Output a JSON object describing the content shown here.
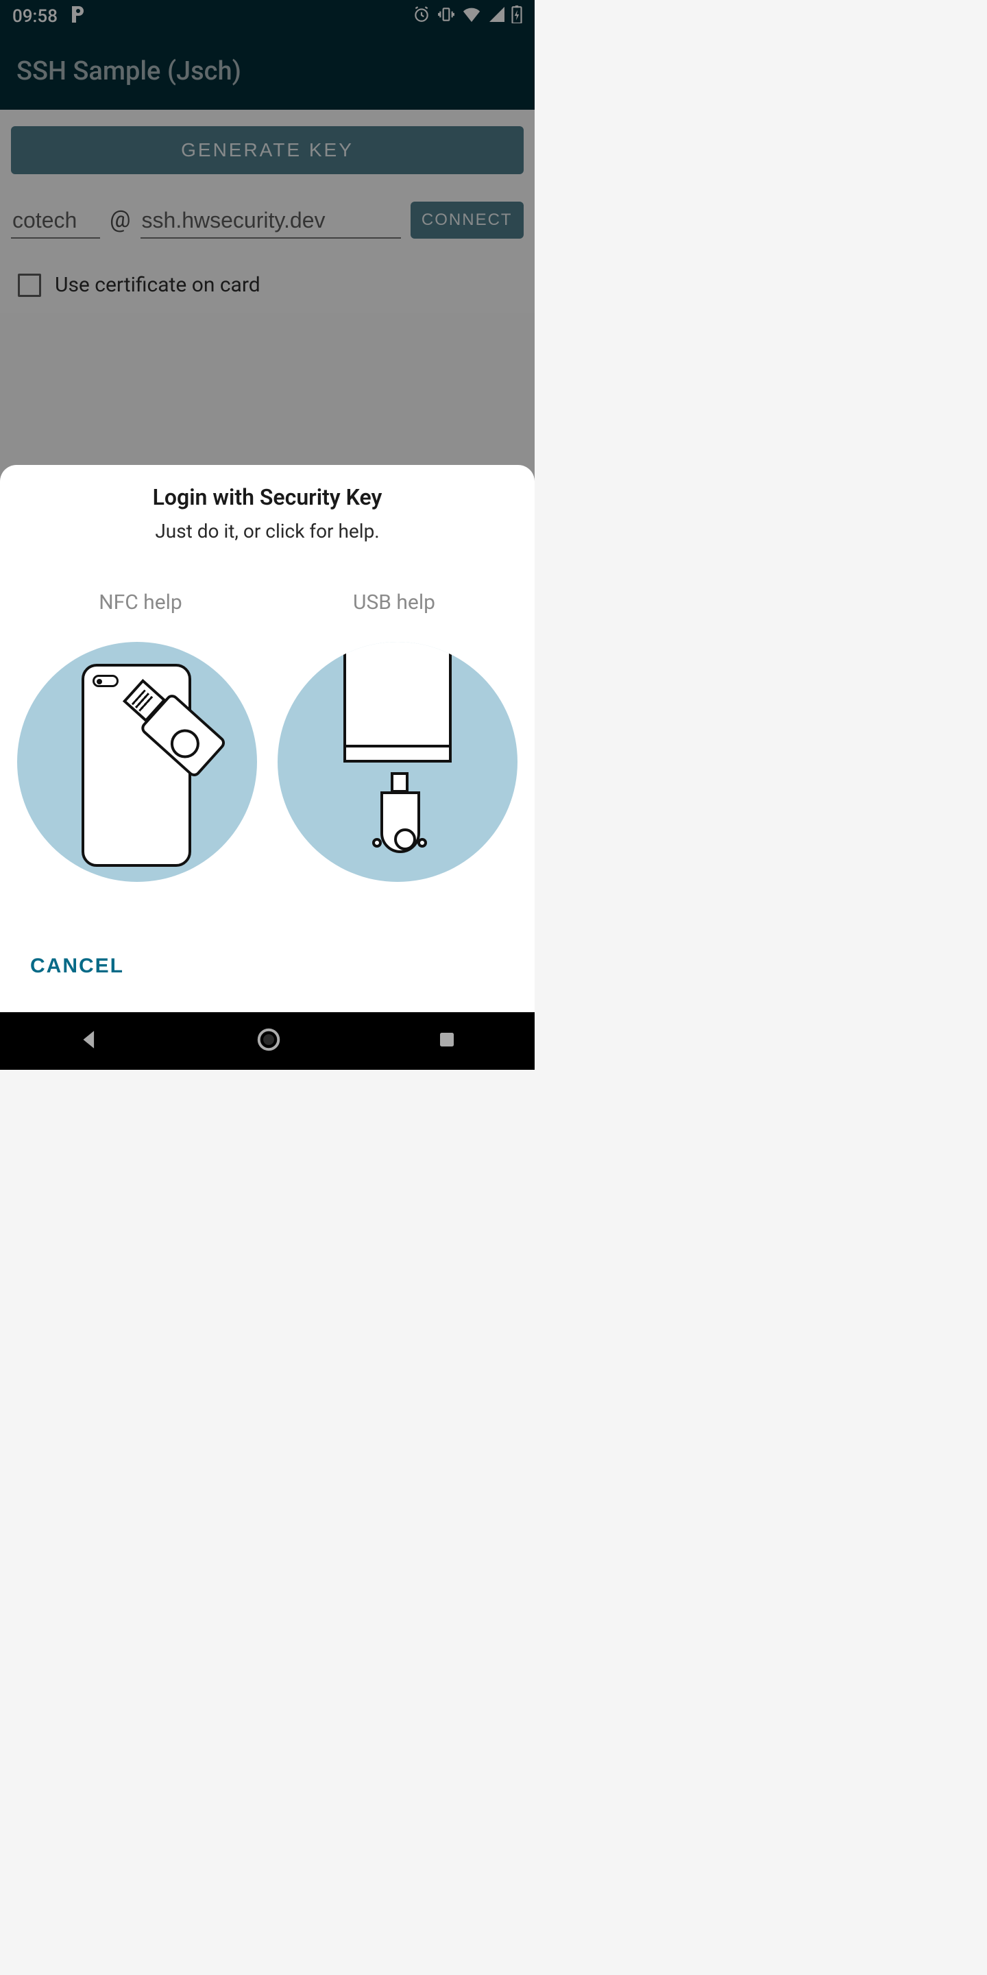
{
  "status": {
    "time": "09:58"
  },
  "app": {
    "title": "SSH Sample (Jsch)"
  },
  "main": {
    "generate_label": "GENERATE KEY",
    "user_value": "cotech",
    "at": "@",
    "host_value": "ssh.hwsecurity.dev",
    "connect_label": "CONNECT",
    "cert_label": "Use certificate on card"
  },
  "dialog": {
    "title": "Login with Security Key",
    "subtitle": "Just do it, or click for help.",
    "nfc_help": "NFC help",
    "usb_help": "USB help",
    "cancel": "CANCEL"
  }
}
